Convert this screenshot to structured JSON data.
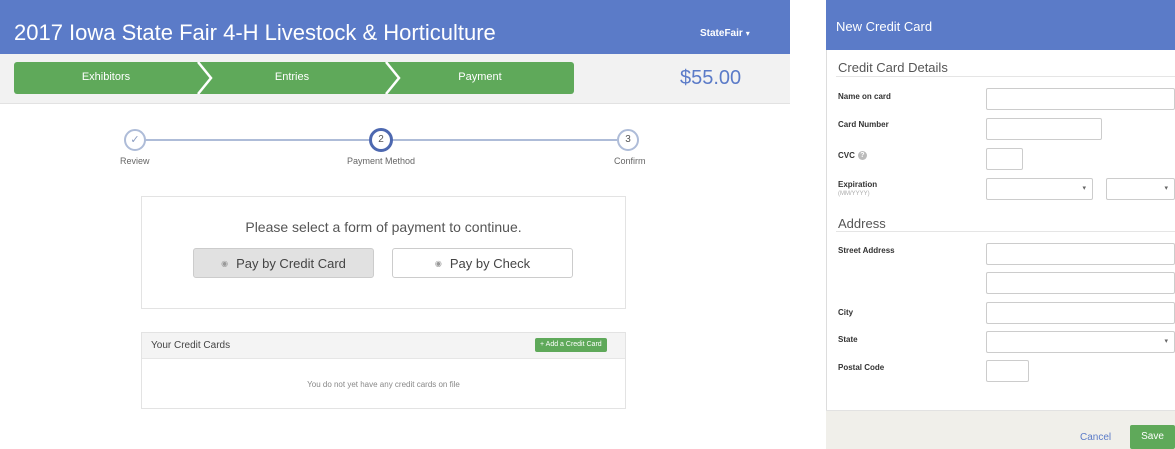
{
  "header": {
    "title": "2017 Iowa State Fair 4-H Livestock & Horticulture",
    "user_menu": "StateFair",
    "caret": "▾"
  },
  "steps": [
    "Exhibitors",
    "Entries",
    "Payment"
  ],
  "total": "$55.00",
  "wizard": {
    "steps": [
      {
        "label": "Review",
        "marker": "✓"
      },
      {
        "label": "Payment Method",
        "marker": "2"
      },
      {
        "label": "Confirm",
        "marker": "3"
      }
    ]
  },
  "payment": {
    "prompt": "Please select a form of payment to continue.",
    "options": [
      {
        "label": "Pay by Credit Card",
        "selected": true
      },
      {
        "label": "Pay by Check",
        "selected": false
      }
    ],
    "radio_glyph": "◉"
  },
  "cards": {
    "title": "Your Credit Cards",
    "add_button": "+ Add a Credit Card",
    "empty": "You do not yet have any credit cards on file"
  },
  "modal": {
    "title": "New Credit Card",
    "card_section": "Credit Card Details",
    "fields": {
      "name": "Name on card",
      "number": "Card Number",
      "cvc": "CVC",
      "expiration": "Expiration",
      "expiration_hint": "(MM/YYYY)"
    },
    "address_section": "Address",
    "address_fields": {
      "street": "Street Address",
      "city": "City",
      "state": "State",
      "postal": "Postal Code"
    },
    "help_glyph": "?",
    "select_caret": "▾",
    "cancel": "Cancel",
    "save": "Save"
  },
  "colors": {
    "brand_blue": "#5b7bc8",
    "green": "#5fa95a"
  }
}
